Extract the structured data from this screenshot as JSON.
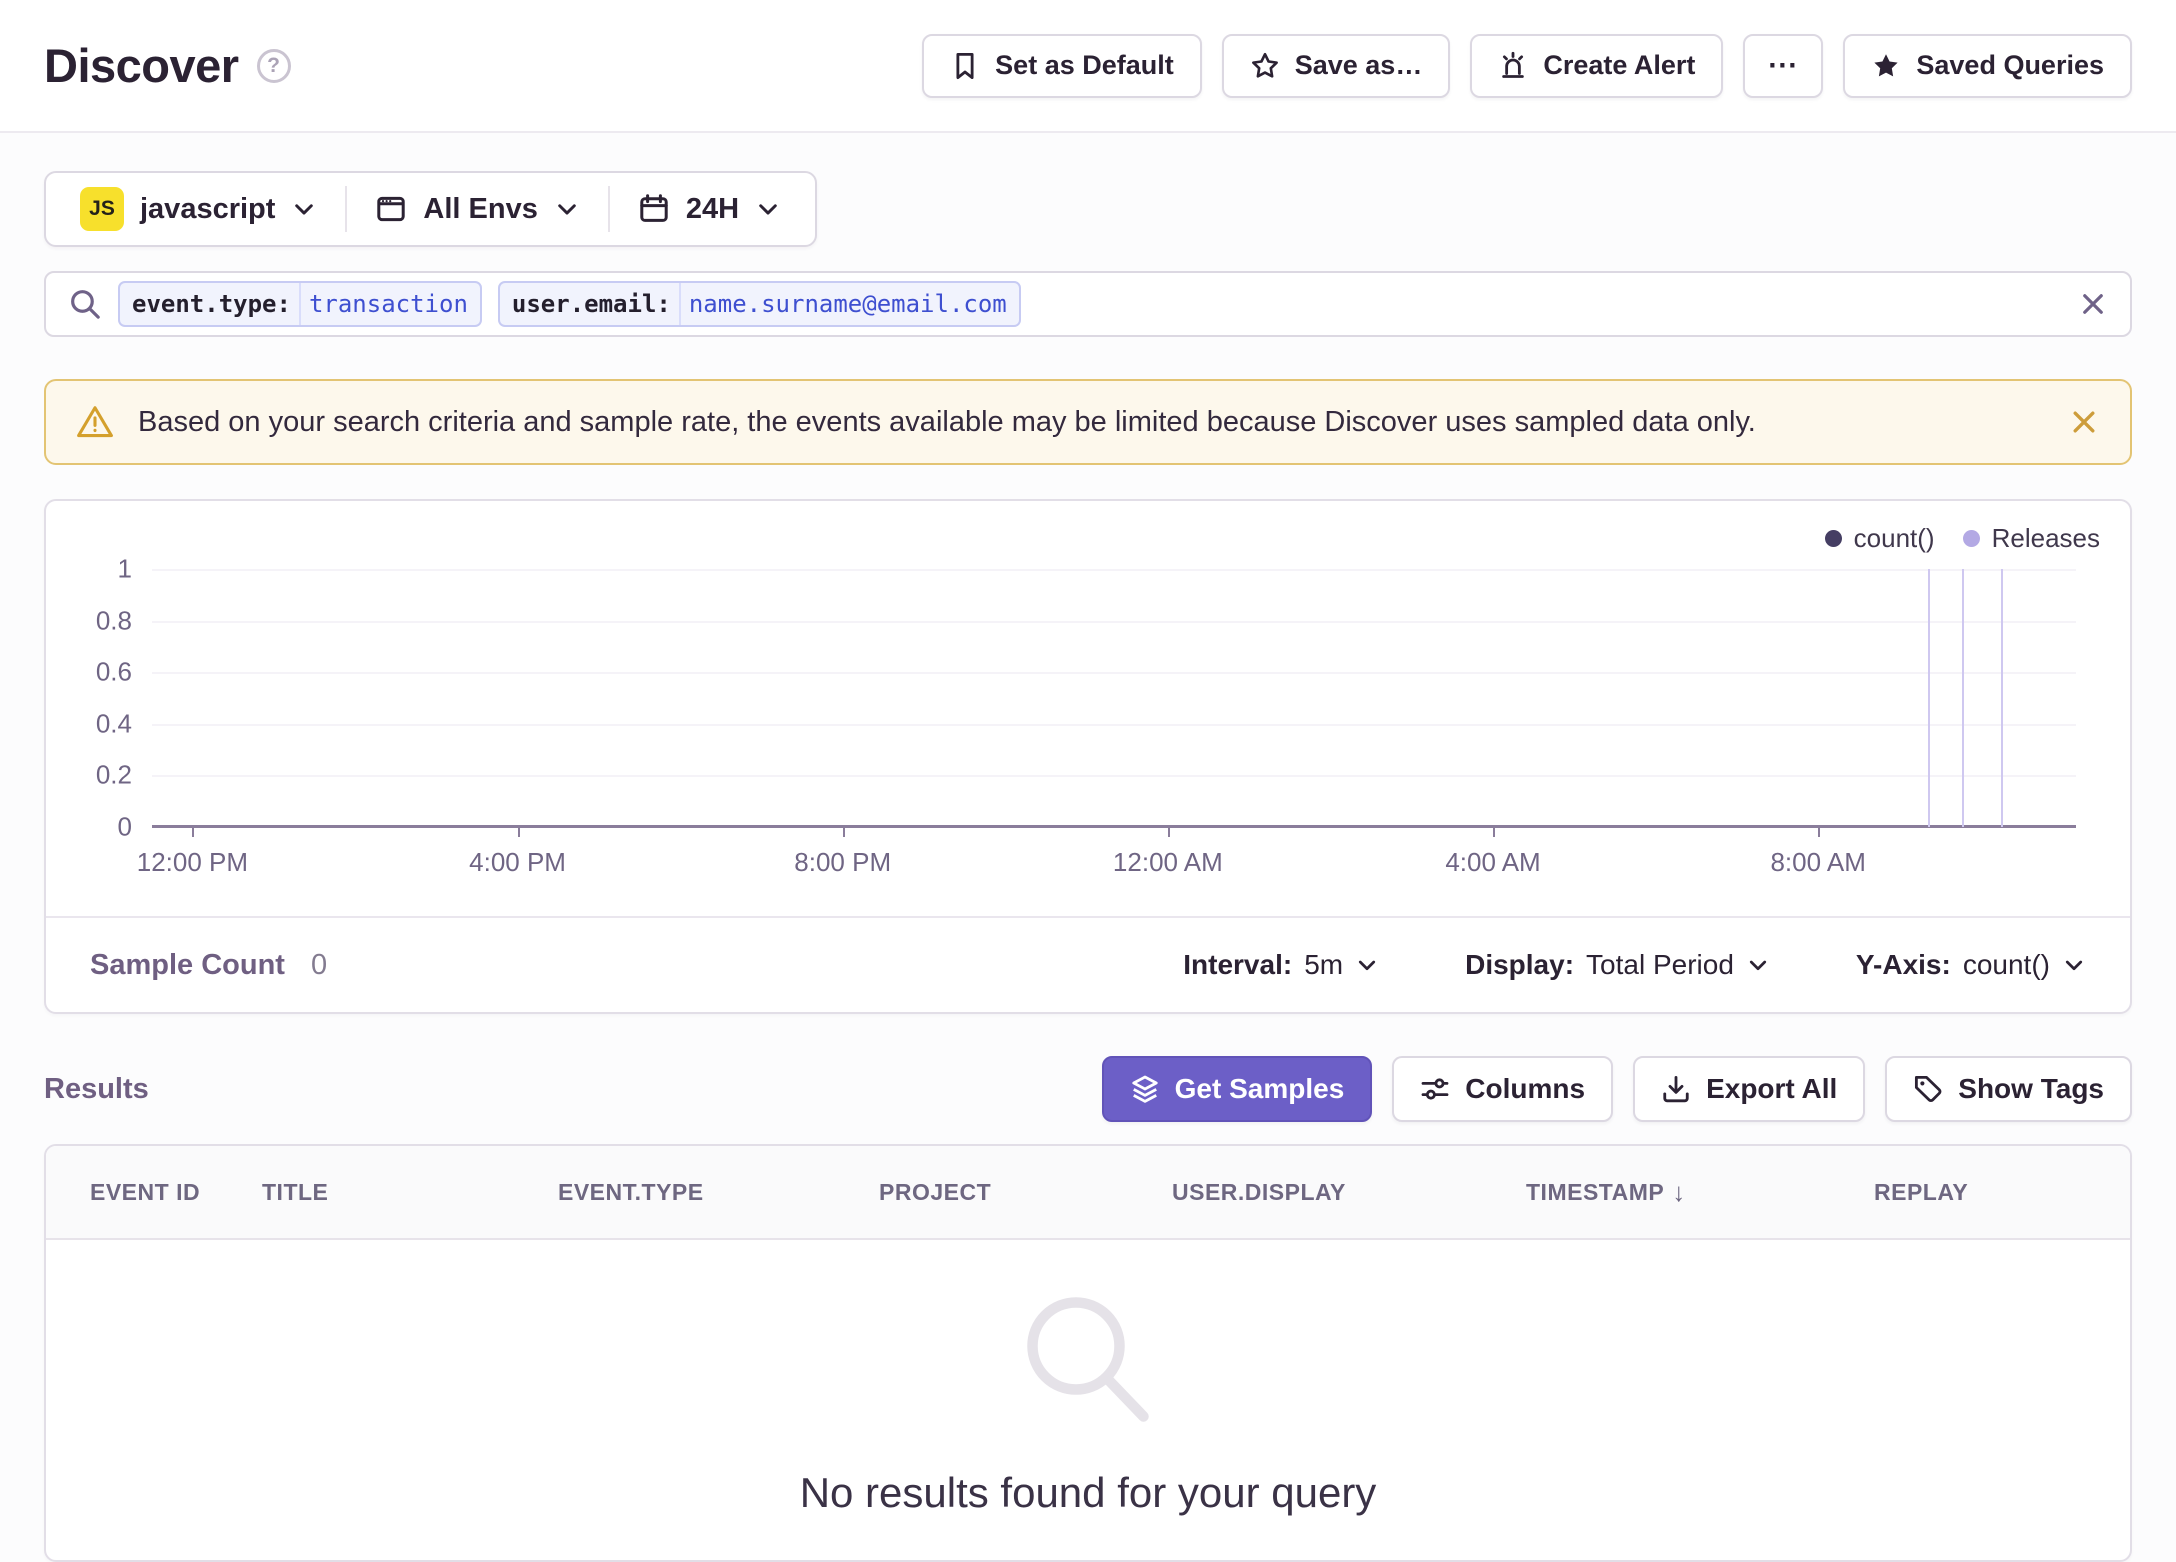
{
  "page": {
    "title": "Discover",
    "help_icon": "?"
  },
  "header": {
    "buttons": [
      {
        "label": "Set as Default",
        "icon": "bookmark"
      },
      {
        "label": "Save as…",
        "icon": "star-outline"
      },
      {
        "label": "Create Alert",
        "icon": "alert-siren"
      },
      {
        "label": "Saved Queries",
        "icon": "star-filled"
      }
    ],
    "more_label": "⋯"
  },
  "filters": {
    "project": {
      "badge": "JS",
      "label": "javascript"
    },
    "environment": {
      "label": "All Envs"
    },
    "time": {
      "label": "24H"
    }
  },
  "search": {
    "tokens": [
      {
        "key": "event.type:",
        "value": "transaction"
      },
      {
        "key": "user.email:",
        "value": "name.surname@email.com"
      }
    ]
  },
  "banner": {
    "text": "Based on your search criteria and sample rate, the events available may be limited because Discover uses sampled data only."
  },
  "chart_data": {
    "type": "line",
    "series": [
      {
        "name": "count()",
        "values": []
      }
    ],
    "y_tick_labels": [
      "1",
      "0.8",
      "0.6",
      "0.4",
      "0.2",
      "0"
    ],
    "x_tick_labels": [
      "12:00 PM",
      "4:00 PM",
      "8:00 PM",
      "12:00 AM",
      "4:00 AM",
      "8:00 AM"
    ],
    "ylim": [
      0,
      1
    ],
    "grid": "horizontal",
    "legend": [
      {
        "label": "count()",
        "color": "#453E63"
      },
      {
        "label": "Releases",
        "color": "#B3A9E4"
      }
    ],
    "releases": {
      "count": 3,
      "x_fractions": [
        0.923,
        0.941,
        0.961
      ]
    }
  },
  "chart_footer": {
    "sample_count_label": "Sample Count",
    "sample_count_value": "0",
    "controls": [
      {
        "label": "Interval:",
        "value": "5m"
      },
      {
        "label": "Display:",
        "value": "Total Period"
      },
      {
        "label": "Y-Axis:",
        "value": "count()"
      }
    ]
  },
  "results": {
    "heading": "Results",
    "actions": {
      "get_samples": "Get Samples",
      "columns": "Columns",
      "export_all": "Export All",
      "show_tags": "Show Tags"
    },
    "table": {
      "columns": [
        "EVENT ID",
        "TITLE",
        "EVENT.TYPE",
        "PROJECT",
        "USER.DISPLAY",
        "TIMESTAMP",
        "REPLAY"
      ],
      "sorted_column": "TIMESTAMP",
      "sort_direction": "desc",
      "sort_arrow": "↓",
      "empty_message": "No results found for your query"
    }
  },
  "colors": {
    "primary": "#6C5FC7",
    "warning_bg": "#FDF8EC",
    "warning_border": "#E3C473",
    "warning_icon": "#D4A02C",
    "token_bg": "#F1F3FD",
    "token_border": "#C7CBF3",
    "token_value_text": "#3E4FD0",
    "release_line": "#CFC8F0",
    "axis_text": "#6F6584"
  }
}
